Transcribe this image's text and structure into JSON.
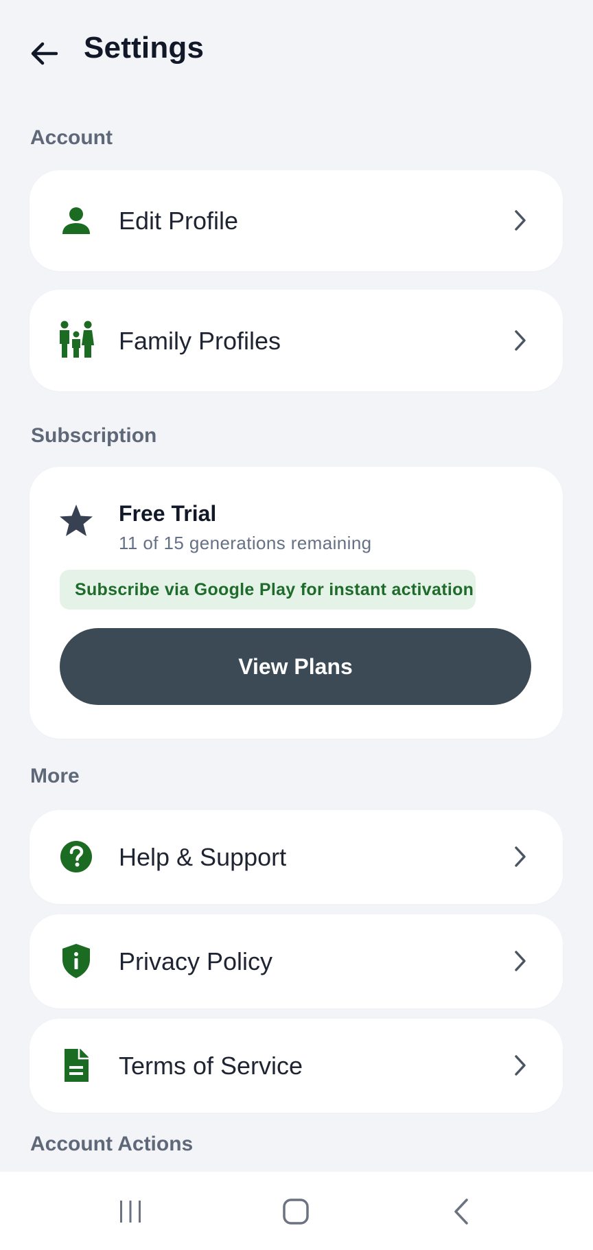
{
  "header": {
    "title": "Settings",
    "back_icon": "arrow-left-icon"
  },
  "sections": {
    "account": {
      "label": "Account",
      "items": [
        {
          "label": "Edit Profile",
          "icon": "person-icon"
        },
        {
          "label": "Family Profiles",
          "icon": "family-icon"
        }
      ]
    },
    "subscription": {
      "label": "Subscription",
      "plan_title": "Free Trial",
      "plan_desc": "11 of 15 generations remaining",
      "promo": "Subscribe via Google Play for instant activation",
      "cta": "View Plans",
      "icon": "star-icon"
    },
    "more": {
      "label": "More",
      "items": [
        {
          "label": "Help & Support",
          "icon": "help-icon"
        },
        {
          "label": "Privacy Policy",
          "icon": "shield-icon"
        },
        {
          "label": "Terms of Service",
          "icon": "document-icon"
        }
      ]
    },
    "account_actions": {
      "label": "Account Actions"
    }
  },
  "colors": {
    "accent_green": "#1b6b22",
    "button_dark": "#3b4a54",
    "promo_bg": "#e5f2e8",
    "promo_text": "#1e6b2c",
    "background": "#f3f4f7"
  },
  "nav": {
    "recents_icon": "recents-icon",
    "home_icon": "home-icon",
    "back_icon": "nav-back-icon"
  }
}
